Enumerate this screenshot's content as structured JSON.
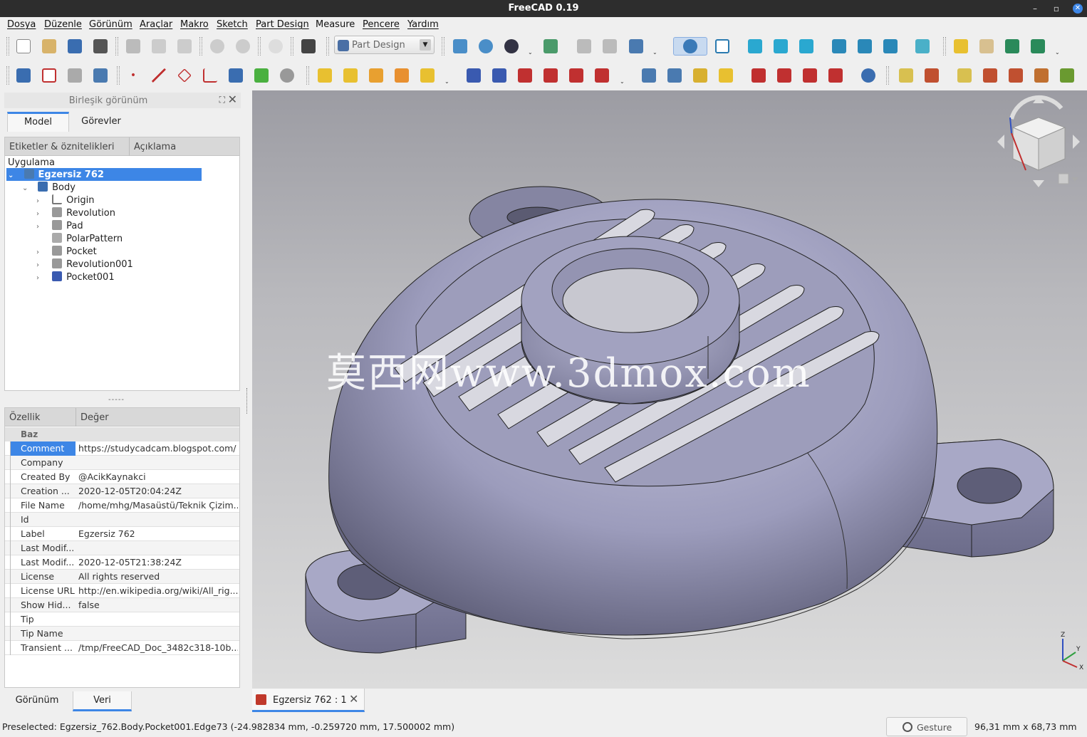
{
  "window": {
    "title": "FreeCAD 0.19"
  },
  "menu": [
    "Dosya",
    "Düzenle",
    "Görünüm",
    "Araçlar",
    "Makro",
    "Sketch",
    "Part Design",
    "Measure",
    "Pencere",
    "Yardım"
  ],
  "toolbar": {
    "workbench": "Part Design"
  },
  "combo_view": {
    "title": "Birleşik görünüm",
    "tabs": [
      "Model",
      "Görevler"
    ],
    "tree_header": {
      "labels": "Etiketler & öznitelikleri",
      "description": "Açıklama"
    },
    "tree_root": "Uygulama",
    "tree": [
      {
        "label": "Egzersiz 762",
        "level": 1
      },
      {
        "label": "Body",
        "level": 2
      },
      {
        "label": "Origin",
        "level": 3
      },
      {
        "label": "Revolution",
        "level": 3
      },
      {
        "label": "Pad",
        "level": 3
      },
      {
        "label": "PolarPattern",
        "level": 3
      },
      {
        "label": "Pocket",
        "level": 3
      },
      {
        "label": "Revolution001",
        "level": 3
      },
      {
        "label": "Pocket001",
        "level": 3
      }
    ],
    "splitter": "-----"
  },
  "properties": {
    "header": {
      "property": "Özellik",
      "value": "Değer"
    },
    "group": "Baz",
    "rows": [
      {
        "key": "Comment",
        "value": "https://studycadcam.blogspot.com/"
      },
      {
        "key": "Company",
        "value": ""
      },
      {
        "key": "Created By",
        "value": "@AcikKaynakci"
      },
      {
        "key": "Creation ...",
        "value": "2020-12-05T20:04:24Z"
      },
      {
        "key": "File Name",
        "value": "/home/mhg/Masaüstü/Teknik Çizim..."
      },
      {
        "key": "Id",
        "value": ""
      },
      {
        "key": "Label",
        "value": "Egzersiz 762"
      },
      {
        "key": "Last Modif...",
        "value": ""
      },
      {
        "key": "Last Modif...",
        "value": "2020-12-05T21:38:24Z"
      },
      {
        "key": "License",
        "value": "All rights reserved"
      },
      {
        "key": "License URL",
        "value": "http://en.wikipedia.org/wiki/All_rig..."
      },
      {
        "key": "Show Hid...",
        "value": "false"
      },
      {
        "key": "Tip",
        "value": ""
      },
      {
        "key": "Tip Name",
        "value": ""
      },
      {
        "key": "Transient ...",
        "value": "/tmp/FreeCAD_Doc_3482c318-10b..."
      }
    ],
    "bottom_tabs": [
      "Görünüm",
      "Veri"
    ]
  },
  "viewport": {
    "watermark": "莫西网www.3dmox.com",
    "axis_labels": {
      "z": "Z",
      "y": "Y",
      "x": "X"
    }
  },
  "document_tab": {
    "label": "Egzersiz 762 : 1"
  },
  "status": {
    "text": "Preselected: Egzersiz_762.Body.Pocket001.Edge73 (-24.982834 mm, -0.259720 mm, 17.500002 mm)",
    "nav_style": "Gesture",
    "dimensions": "96,31 mm x 68,73 mm"
  },
  "colors": {
    "accent": "#3d86e6",
    "model": "#8a8aa8",
    "titlebar": "#2d2d2d"
  }
}
